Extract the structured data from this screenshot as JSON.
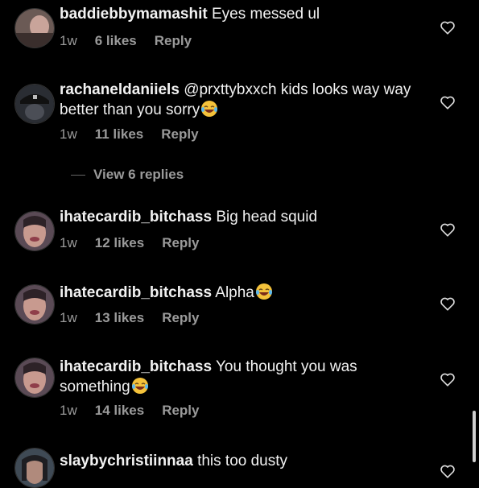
{
  "comments": [
    {
      "username": "baddiebbymamashit",
      "text": "Eyes messed ul",
      "emoji": false,
      "time": "1w",
      "likes": "6 likes",
      "reply": "Reply"
    },
    {
      "username": "rachaneldaniiels",
      "text": "@prxttybxxch kids looks way way better than you sorry",
      "emoji": true,
      "time": "1w",
      "likes": "11 likes",
      "reply": "Reply"
    },
    {
      "username": "ihatecardib_bitchass",
      "text": "Big head squid",
      "emoji": false,
      "time": "1w",
      "likes": "12 likes",
      "reply": "Reply"
    },
    {
      "username": "ihatecardib_bitchass",
      "text": "Alpha",
      "emoji": true,
      "time": "1w",
      "likes": "13 likes",
      "reply": "Reply"
    },
    {
      "username": "ihatecardib_bitchass",
      "text": "You thought you was something",
      "emoji": true,
      "time": "1w",
      "likes": "14 likes",
      "reply": "Reply"
    },
    {
      "username": "slaybychristiinnaa",
      "text": "this too dusty",
      "emoji": false
    }
  ],
  "view_replies": "View 6 replies",
  "icons": {
    "heart": "heart-outline-icon",
    "emoji": "laughing-tears-emoji"
  },
  "colors": {
    "background": "#000000",
    "meta": "#9a9a9a",
    "text": "#f2f2f2"
  }
}
